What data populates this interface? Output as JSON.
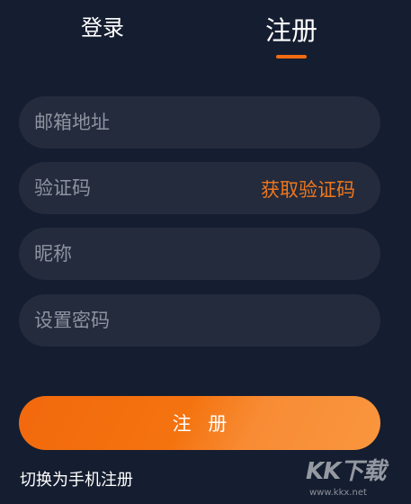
{
  "tabs": {
    "login_label": "登录",
    "register_label": "注册",
    "active": "register"
  },
  "form": {
    "email_placeholder": "邮箱地址",
    "code_placeholder": "验证码",
    "get_code_label": "获取验证码",
    "nickname_placeholder": "昵称",
    "password_placeholder": "设置密码",
    "submit_label": "注 册"
  },
  "footer": {
    "switch_label": "切换为手机注册"
  },
  "watermark": {
    "logo_text": "KK下载",
    "url_text": "www.kkx.net"
  },
  "colors": {
    "background": "#151d30",
    "field_background": "#232b3d",
    "accent": "#f26b13"
  }
}
